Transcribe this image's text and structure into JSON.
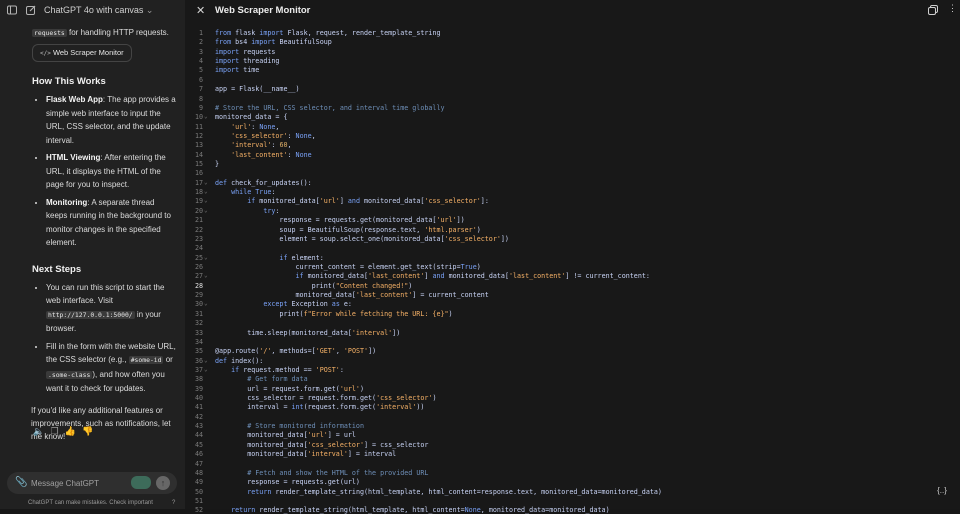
{
  "topbar": {
    "model_label": "ChatGPT 4o with canvas"
  },
  "chat": {
    "intro_code": "requests",
    "intro_text": " for handling HTTP requests.",
    "chip_label": "Web Scraper Monitor",
    "how_title": "How This Works",
    "bullets_how": [
      {
        "bold": "Flask Web App",
        "text": ": The app provides a simple web interface to input the URL, CSS selector, and the update interval."
      },
      {
        "bold": "HTML Viewing",
        "text": ": After entering the URL, it displays the HTML of the page for you to inspect."
      },
      {
        "bold": "Monitoring",
        "text": ": A separate thread keeps running in the background to monitor changes in the specified element."
      }
    ],
    "next_title": "Next Steps",
    "next1_a": "You can run this script to start the web interface. Visit ",
    "next1_code": "http://127.0.0.1:5000/",
    "next1_b": " in your browser.",
    "next2_a": "Fill in the form with the website URL, the CSS selector (e.g., ",
    "next2_code1": "#some-id",
    "next2_b": " or ",
    "next2_code2": ".some-class",
    "next2_c": "), and how often you want it to check for updates.",
    "closing": "If you'd like any additional features or improvements, such as notifications, let me know!"
  },
  "composer": {
    "placeholder": "Message ChatGPT",
    "disclaimer": "ChatGPT can make mistakes. Check important"
  },
  "canvas": {
    "title": "Web Scraper Monitor",
    "active_line": 28,
    "lines": [
      "from flask import Flask, request, render_template_string",
      "from bs4 import BeautifulSoup",
      "import requests",
      "import threading",
      "import time",
      "",
      "app = Flask(__name__)",
      "",
      "# Store the URL, CSS selector, and interval time globally",
      "monitored_data = {",
      "    'url': None,",
      "    'css_selector': None,",
      "    'interval': 60,",
      "    'last_content': None",
      "}",
      "",
      "def check_for_updates():",
      "    while True:",
      "        if monitored_data['url'] and monitored_data['css_selector']:",
      "            try:",
      "                response = requests.get(monitored_data['url'])",
      "                soup = BeautifulSoup(response.text, 'html.parser')",
      "                element = soup.select_one(monitored_data['css_selector'])",
      "",
      "                if element:",
      "                    current_content = element.get_text(strip=True)",
      "                    if monitored_data['last_content'] and monitored_data['last_content'] != current_content:",
      "                        print(\"Content changed!\")",
      "                    monitored_data['last_content'] = current_content",
      "            except Exception as e:",
      "                print(f\"Error while fetching the URL: {e}\")",
      "",
      "        time.sleep(monitored_data['interval'])",
      "",
      "@app.route('/', methods=['GET', 'POST'])",
      "def index():",
      "    if request.method == 'POST':",
      "        # Get form data",
      "        url = request.form.get('url')",
      "        css_selector = request.form.get('css_selector')",
      "        interval = int(request.form.get('interval'))",
      "",
      "        # Store monitored information",
      "        monitored_data['url'] = url",
      "        monitored_data['css_selector'] = css_selector",
      "        monitored_data['interval'] = interval",
      "",
      "        # Fetch and show the HTML of the provided URL",
      "        response = requests.get(url)",
      "        return render_template_string(html_template, html_content=response.text, monitored_data=monitored_data)",
      "",
      "    return render_template_string(html_template, html_content=None, monitored_data=monitored_data)"
    ],
    "fold_lines": [
      10,
      17,
      18,
      19,
      20,
      25,
      27,
      30,
      36,
      37
    ]
  },
  "icons": {
    "sidebar": "sidebar-toggle-icon",
    "new_chat": "edit-icon",
    "close": "close-icon",
    "copy": "copy-icon",
    "attach": "paperclip-icon",
    "send": "arrow-up-icon",
    "code_tools": "code-braces-icon"
  }
}
